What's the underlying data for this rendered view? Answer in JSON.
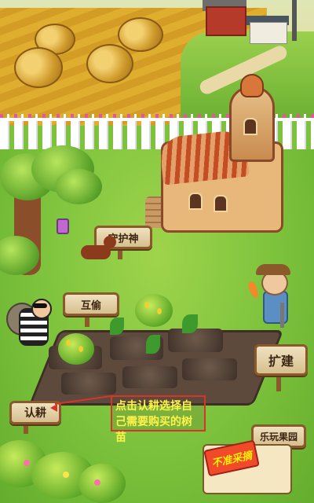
{
  "signs": {
    "guardian": "守护神",
    "steal": "互偷",
    "expand": "扩建",
    "adopt": "认耕",
    "orchard": "乐玩果园"
  },
  "hint": {
    "text": "点击认耕选择自己需要购买的树苗"
  },
  "stall": {
    "label": "不准采摘"
  },
  "colors": {
    "highlight_border": "#d8352a",
    "hint_text": "#fff34a",
    "grass": "#7cc23c",
    "soil": "#5e4a3c"
  },
  "icons": [
    "hay-bale-icon",
    "tree-icon",
    "castle-house-icon",
    "dog-icon",
    "thief-icon",
    "farmer-icon",
    "sapling-icon",
    "fruit-tree-icon",
    "lantern-icon"
  ]
}
